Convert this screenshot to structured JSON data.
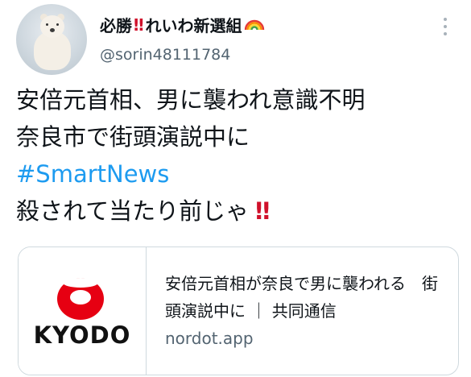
{
  "author": {
    "display_name": "必勝",
    "display_name_bang": "‼",
    "display_name_rest": "れいわ新選組",
    "display_name_emoji": "🌈",
    "handle": "@sorin48111784",
    "avatar": "polar-bear-avatar"
  },
  "tweet": {
    "line1": "安倍元首相、男に襲われ意識不明",
    "line2": "奈良市で街頭演説中に",
    "hashtag": "#SmartNews",
    "line4": "殺されて当たり前じゃ",
    "line4_bang": "‼"
  },
  "card": {
    "logo_text": "KYODO",
    "title": "安倍元首相が奈良で男に襲われる　街頭演説中に ｜ 共同通信",
    "domain": "nordot.app"
  },
  "colors": {
    "hashtag": "#1d9bf0",
    "bang": "#d0112b",
    "kyodo_red": "#e60012",
    "secondary_text": "#536471"
  }
}
